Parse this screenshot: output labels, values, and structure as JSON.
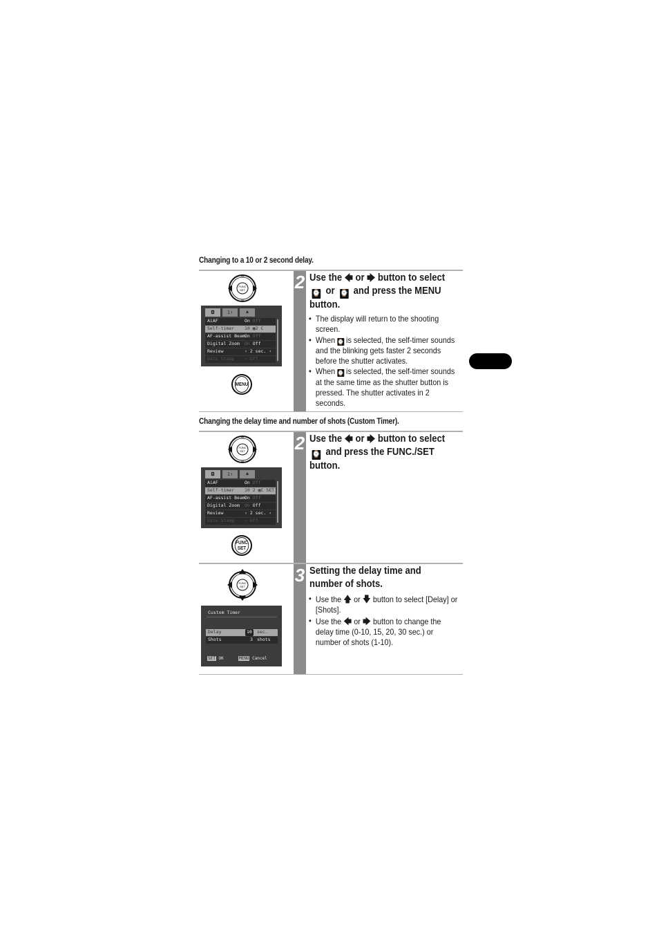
{
  "sections": [
    {
      "title": "Changing to a 10 or 2 second delay.",
      "step": {
        "number": "2",
        "heading": {
          "part1": "Use the",
          "left_arrow": "left-arrow-icon",
          "or1": "or",
          "right_arrow": "right-arrow-icon",
          "part2": "button to select",
          "icon1": "self-timer-10s-icon",
          "or2": "or",
          "icon2": "self-timer-2s-icon",
          "part3": "and press the MENU button."
        },
        "bullets": [
          {
            "text": "The display will return to the shooting screen."
          },
          {
            "pre": "When",
            "icon": "self-timer-10s-icon",
            "post": "is selected, the self-timer sounds and the blinking gets faster 2 seconds before the shutter activates."
          },
          {
            "pre": "When",
            "icon": "self-timer-2s-icon",
            "post": "is selected, the self-timer sounds at the same time as the shutter button is pressed. The shutter activates in 2 seconds."
          }
        ],
        "button_label": "MENU",
        "lcd": {
          "tabs": [
            "camera-icon",
            "setup-icon",
            "my-camera-icon"
          ],
          "rows": [
            {
              "label": "AiAF",
              "value": "On",
              "dim": "Off"
            },
            {
              "label": "Self-timer",
              "value": "10 ▣2 C",
              "selected": true
            },
            {
              "label": "AF-assist Beam",
              "value": "On",
              "dim": "Off"
            },
            {
              "label": "Digital Zoom",
              "dim_pre": "On",
              "value": "Off"
            },
            {
              "label": "Review",
              "value": "‹ 2 sec.  ›"
            },
            {
              "label": "Date Stamp",
              "value": "‹ Off",
              "faded": true
            }
          ]
        }
      }
    },
    {
      "title": "Changing the delay time and number of shots (Custom Timer).",
      "step": {
        "number": "2",
        "heading": {
          "part1": "Use the",
          "left_arrow": "left-arrow-icon",
          "or1": "or",
          "right_arrow": "right-arrow-icon",
          "part2": "button to select",
          "icon1": "custom-timer-icon",
          "part3": "and press the FUNC./SET button."
        },
        "button_label_line1": "FUNC",
        "button_label_line2": "SET",
        "lcd": {
          "rows": [
            {
              "label": "AiAF",
              "value": "On",
              "dim": "Off"
            },
            {
              "label": "Self-timer",
              "value": "10 2 ▣C SET",
              "selected": true
            },
            {
              "label": "AF-assist Beam",
              "value": "On",
              "dim": "Off"
            },
            {
              "label": "Digital Zoom",
              "dim_pre": "On",
              "value": "Off"
            },
            {
              "label": "Review",
              "value": "‹ 2 sec.  ›"
            },
            {
              "label": "Date Stamp",
              "value": "‹ Off",
              "faded": true
            }
          ]
        }
      }
    },
    {
      "step": {
        "number": "3",
        "heading_text": "Setting the delay time and number of shots.",
        "bullets": [
          {
            "pre": "Use the",
            "a1": "up-arrow-icon",
            "mid": "or",
            "a2": "down-arrow-icon",
            "post": "button to select [Delay] or [Shots]."
          },
          {
            "pre": "Use the",
            "a1": "left-arrow-icon",
            "mid": "or",
            "a2": "right-arrow-icon",
            "post": "button to change the delay time (0-10, 15, 20, 30 sec.) or number of shots (1-10)."
          }
        ],
        "lcd": {
          "title": "Custom Timer",
          "delay_label": "Delay",
          "delay_value": "10",
          "delay_unit": "sec.",
          "shots_label": "Shots",
          "shots_value": "3",
          "shots_unit": "shots",
          "ok_key": "SET",
          "ok_label": "OK",
          "cancel_key": "MENU",
          "cancel_label": "Cancel"
        }
      }
    }
  ]
}
